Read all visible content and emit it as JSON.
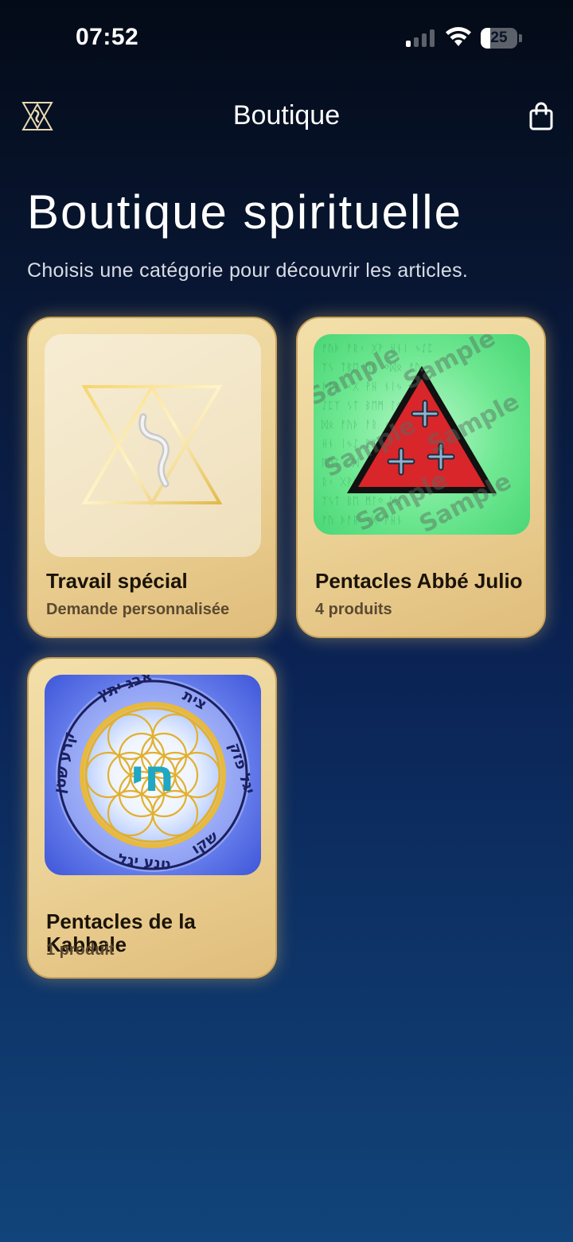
{
  "status_bar": {
    "time": "07:52",
    "battery_level": "25",
    "signal_bars_active": 1,
    "signal_bars_total": 4,
    "icons": [
      "signal-icon",
      "wifi-icon",
      "battery-icon"
    ]
  },
  "nav": {
    "title": "Boutique",
    "logo_icon": "hourglass-hebrew-logo-icon",
    "cart_icon": "shopping-bag-icon"
  },
  "header": {
    "title": "Boutique spirituelle",
    "subtitle": "Choisis une catégorie pour découvrir les articles."
  },
  "categories": [
    {
      "title": "Travail spécial",
      "subtitle": "Demande personnalisée",
      "image": "hourglass-hebrew-emblem"
    },
    {
      "title": "Pentacles Abbé Julio",
      "subtitle": "4 produits",
      "image": "red-triangle-crosses-pentacle",
      "watermark": "Sample"
    },
    {
      "title": "Pentacles de la Kabbale",
      "subtitle": "1 produit",
      "image": "flower-of-life-chai-pentacle",
      "center_glyph": "חי"
    }
  ],
  "colors": {
    "background_top": "#040b17",
    "background_bottom": "#11447a",
    "card_gold": "#ebd195",
    "card_border": "#c9a35c",
    "card_title": "#1b1308",
    "card_subtitle": "#5b4a31"
  }
}
